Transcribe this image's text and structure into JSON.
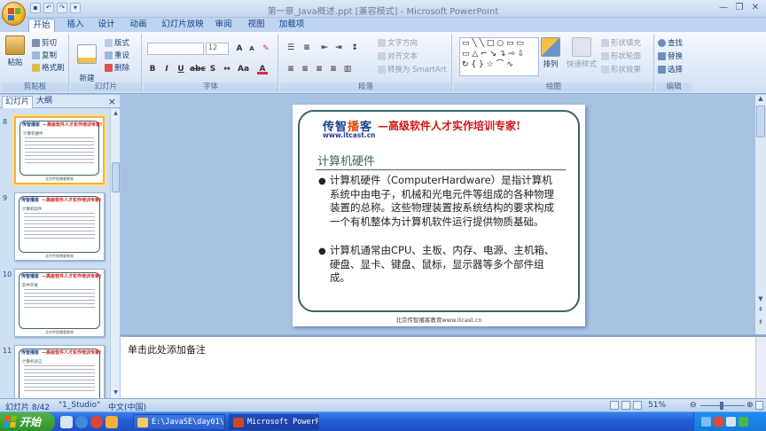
{
  "window": {
    "title": "第一章_Java概述.ppt [兼容模式] - Microsoft PowerPoint"
  },
  "ribbon_tabs": [
    "开始",
    "插入",
    "设计",
    "动画",
    "幻灯片放映",
    "审阅",
    "视图",
    "加载项"
  ],
  "ribbon": {
    "clipboard": {
      "label": "剪贴板",
      "paste": "粘贴",
      "cut": "剪切",
      "copy": "复制",
      "format_painter": "格式刷"
    },
    "slides": {
      "label": "幻灯片",
      "new_slide": "新建\n幻灯片",
      "layout": "版式",
      "reset": "重设",
      "delete": "删除"
    },
    "font": {
      "label": "字体",
      "font_size": "12"
    },
    "paragraph": {
      "label": "段落",
      "text_direction": "文字方向",
      "align_text": "对齐文本",
      "smartart": "转换为 SmartArt"
    },
    "drawing": {
      "label": "绘图",
      "arrange": "排列",
      "quick_styles": "快速样式",
      "shape_fill": "形状填充",
      "shape_outline": "形状轮廓",
      "shape_effects": "形状效果"
    },
    "editing": {
      "label": "编辑",
      "find": "查找",
      "replace": "替换",
      "select": "选择"
    }
  },
  "panel": {
    "tabs": [
      "幻灯片",
      "大纲"
    ],
    "close": "×"
  },
  "thumbnails": [
    {
      "num": "8",
      "title": "计算机硬件",
      "selected": true
    },
    {
      "num": "9",
      "title": "计算机软件",
      "selected": false
    },
    {
      "num": "10",
      "title": "软件开发",
      "selected": false
    },
    {
      "num": "11",
      "title": "计算机语言",
      "selected": false
    }
  ],
  "slide": {
    "brand_name_a": "传智",
    "brand_name_b": "播",
    "brand_name_c": "客",
    "brand_url": "www.itcast.cn",
    "slogan": "—高级软件人才实作培训专家!",
    "title": "计算机硬件",
    "bullets": [
      "计算机硬件（ComputerHardware）是指计算机系统中由电子，机械和光电元件等组成的各种物理装置的总称。这些物理装置按系统结构的要求构成一个有机整体为计算机软件运行提供物质基础。",
      "计算机通常由CPU、主板、内存、电源、主机箱、硬盘、显卡、键盘、鼠标，显示器等多个部件组成。"
    ],
    "footer": "北京传智播客教育www.itcast.cn"
  },
  "notes": {
    "placeholder": "单击此处添加备注"
  },
  "status": {
    "slide_pos": "幻灯片 8/42",
    "theme": "\"1_Studio\"",
    "language": "中文(中国)",
    "zoom": "51%"
  },
  "taskbar": {
    "start": "开始",
    "tasks": [
      {
        "label": "E:\\JavaSE\\day01\\...",
        "active": false
      },
      {
        "label": "Microsoft PowerP...",
        "active": true
      }
    ]
  }
}
